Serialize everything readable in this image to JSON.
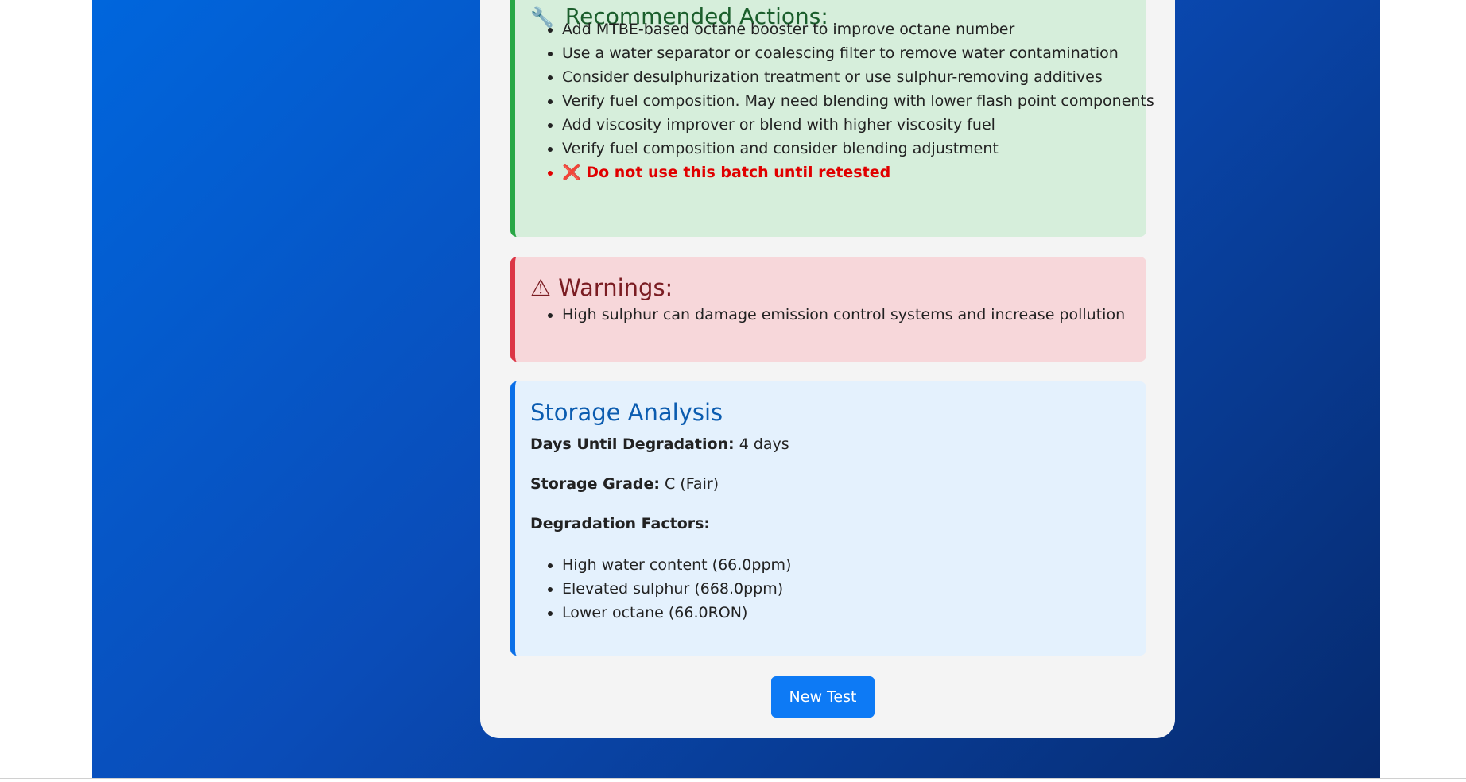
{
  "actions": {
    "icon": "wrench-icon",
    "title": "Recommended Actions:",
    "items": [
      "Add MTBE-based octane booster to improve octane number",
      "Use a water separator or coalescing filter to remove water contamination",
      "Consider desulphurization treatment or use sulphur-removing additives",
      "Verify fuel composition. May need blending with lower flash point components",
      "Add viscosity improver or blend with higher viscosity fuel",
      "Verify fuel composition and consider blending adjustment"
    ],
    "critical": "Do not use this batch until retested",
    "critical_icon": "cross-mark-icon"
  },
  "warnings": {
    "icon": "warning-icon",
    "title": "Warnings:",
    "items": [
      "High sulphur can damage emission control systems and increase pollution"
    ]
  },
  "storage": {
    "title": "Storage Analysis",
    "days_label": "Days Until Degradation:",
    "days_value": "4 days",
    "grade_label": "Storage Grade:",
    "grade_value": "C (Fair)",
    "factors_label": "Degradation Factors:",
    "factors": [
      "High water content (66.0ppm)",
      "Elevated sulphur (668.0ppm)",
      "Lower octane (66.0RON)"
    ]
  },
  "button": {
    "new_test": "New Test"
  },
  "colors": {
    "background_gradient_start": "#0066dd",
    "background_gradient_end": "#062a6e",
    "success_accent": "#28a745",
    "danger_accent": "#dc3545",
    "info_accent": "#0a6fe8",
    "critical_text": "#e00000",
    "button": "#0d7af5"
  }
}
